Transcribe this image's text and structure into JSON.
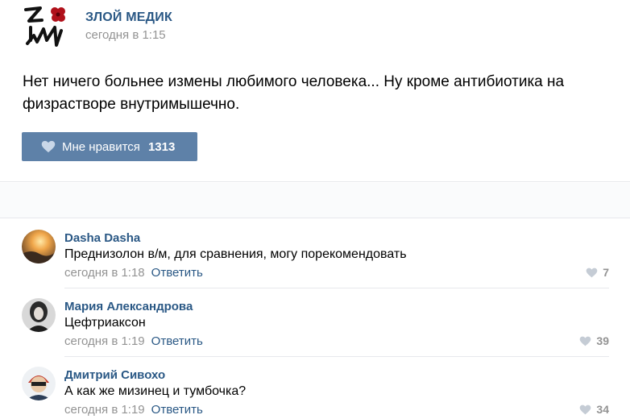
{
  "post": {
    "author": "ЗЛОЙ МЕДИК",
    "time": "сегодня в 1:15",
    "text": "Нет ничего больнее измены любимого человека... Ну кроме антибиотика на физрастворе внутримышечно.",
    "like_label": "Мне нравится",
    "like_count": "1313"
  },
  "comments": [
    {
      "name": "Dasha Dasha",
      "text": "Преднизолон в/м, для сравнения, могу порекомендовать",
      "time": "сегодня в 1:18",
      "reply": "Ответить",
      "likes": "7"
    },
    {
      "name": "Мария Александрова",
      "text": "Цефтриаксон",
      "time": "сегодня в 1:19",
      "reply": "Ответить",
      "likes": "39"
    },
    {
      "name": "Дмитрий Сивохо",
      "text": "А как же мизинец и тумбочка?",
      "time": "сегодня в 1:19",
      "reply": "Ответить",
      "likes": "34"
    }
  ],
  "colors": {
    "link": "#2a5885",
    "button": "#5e81a8",
    "muted": "#939393",
    "logo_flower": "#b0101a"
  },
  "icons": {
    "like": "heart-icon",
    "logo": "zm-logo-icon"
  }
}
